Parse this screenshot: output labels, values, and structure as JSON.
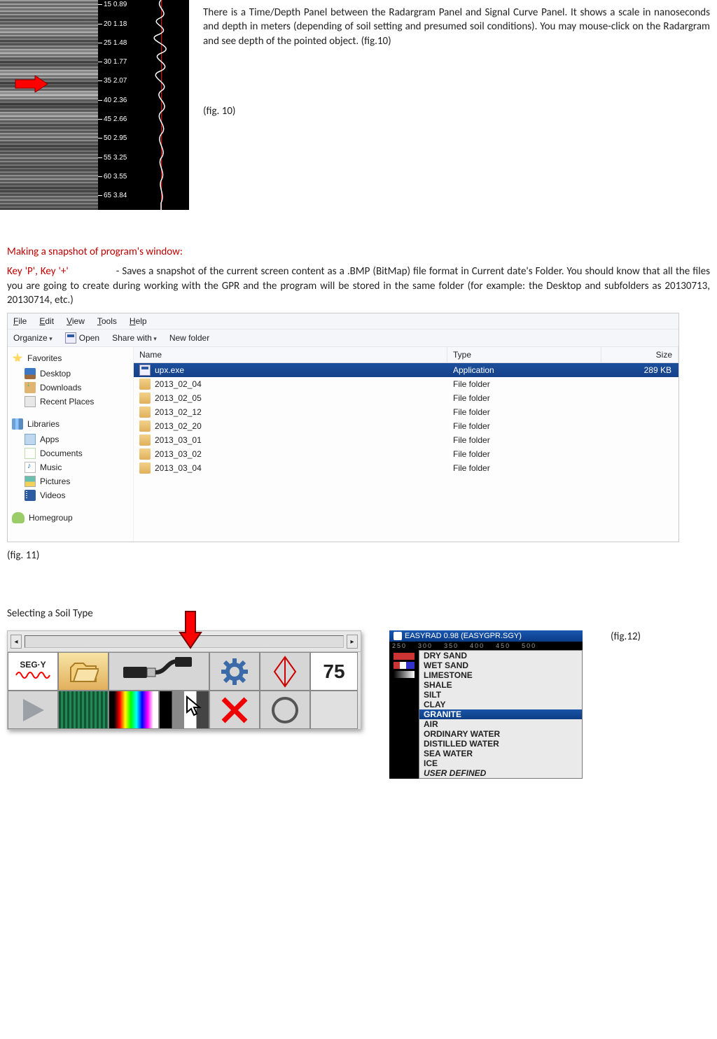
{
  "top": {
    "paragraph": "There is a Time/Depth Panel between the Radargram Panel and Signal Curve Panel. It shows a scale in nanoseconds and depth in meters (depending of soil setting and presumed soil conditions). You may mouse-click on the Radargram and see depth of the pointed object. (fig.10)",
    "caption": "(fig. 10)"
  },
  "depth_scale": [
    {
      "ns": "15",
      "m": "0.89"
    },
    {
      "ns": "20",
      "m": "1.18"
    },
    {
      "ns": "25",
      "m": "1.48"
    },
    {
      "ns": "30",
      "m": "1.77"
    },
    {
      "ns": "35",
      "m": "2.07"
    },
    {
      "ns": "40",
      "m": "2.36"
    },
    {
      "ns": "45",
      "m": "2.66"
    },
    {
      "ns": "50",
      "m": "2.95"
    },
    {
      "ns": "55",
      "m": "3.25"
    },
    {
      "ns": "60",
      "m": "3.55"
    },
    {
      "ns": "65",
      "m": "3.84"
    }
  ],
  "snapshot": {
    "heading": "Making a snapshot of program's window:",
    "keys": "Key 'P', Key '+'",
    "body_after_keys": " - Saves a snapshot of the current  screen content  as a .BMP  (BitMap)  file  format in Current date's Folder. You should know that all the files you are going to create during working with the GPR and the program will be stored in the same folder (for example: the Desktop and subfolders as 20130713, 20130714, etc.)"
  },
  "explorer": {
    "menu": {
      "file": "File",
      "edit": "Edit",
      "view": "View",
      "tools": "Tools",
      "help": "Help"
    },
    "toolbar": {
      "organize": "Organize",
      "open": "Open",
      "share": "Share with",
      "newfolder": "New folder"
    },
    "nav": {
      "favorites": "Favorites",
      "desktop": "Desktop",
      "downloads": "Downloads",
      "recent": "Recent Places",
      "libraries": "Libraries",
      "apps": "Apps",
      "documents": "Documents",
      "music": "Music",
      "pictures": "Pictures",
      "videos": "Videos",
      "homegroup": "Homegroup"
    },
    "cols": {
      "name": "Name",
      "type": "Type",
      "size": "Size"
    },
    "rows": [
      {
        "name": "upx.exe",
        "type": "Application",
        "size": "289 KB",
        "icon": "exe",
        "selected": true
      },
      {
        "name": "2013_02_04",
        "type": "File folder",
        "size": "",
        "icon": "folder"
      },
      {
        "name": "2013_02_05",
        "type": "File folder",
        "size": "",
        "icon": "folder"
      },
      {
        "name": "2013_02_12",
        "type": "File folder",
        "size": "",
        "icon": "folder"
      },
      {
        "name": "2013_02_20",
        "type": "File folder",
        "size": "",
        "icon": "folder"
      },
      {
        "name": "2013_03_01",
        "type": "File folder",
        "size": "",
        "icon": "folder"
      },
      {
        "name": "2013_03_02",
        "type": "File folder",
        "size": "",
        "icon": "folder"
      },
      {
        "name": "2013_03_04",
        "type": "File folder",
        "size": "",
        "icon": "folder"
      }
    ],
    "caption": "(fig. 11)"
  },
  "soil_section_heading": "Selecting a Soil Type",
  "toolbar_panel": {
    "num_value": "75",
    "segy_label": "SEG·Y"
  },
  "soil_dropdown": {
    "title": "EASYRAD 0.98 (EASYGPR.SGY)",
    "ruler": [
      "250",
      "300",
      "350",
      "400",
      "450",
      "500"
    ],
    "items": [
      "DRY SAND",
      "WET SAND",
      "LIMESTONE",
      "SHALE",
      "SILT",
      "CLAY",
      "GRANITE",
      "AIR",
      "ORDINARY WATER",
      "DISTILLED WATER",
      "SEA WATER",
      "ICE",
      "USER DEFINED"
    ],
    "selected_index": 6,
    "italic_index": 12
  },
  "fig12": "(fig.12)"
}
